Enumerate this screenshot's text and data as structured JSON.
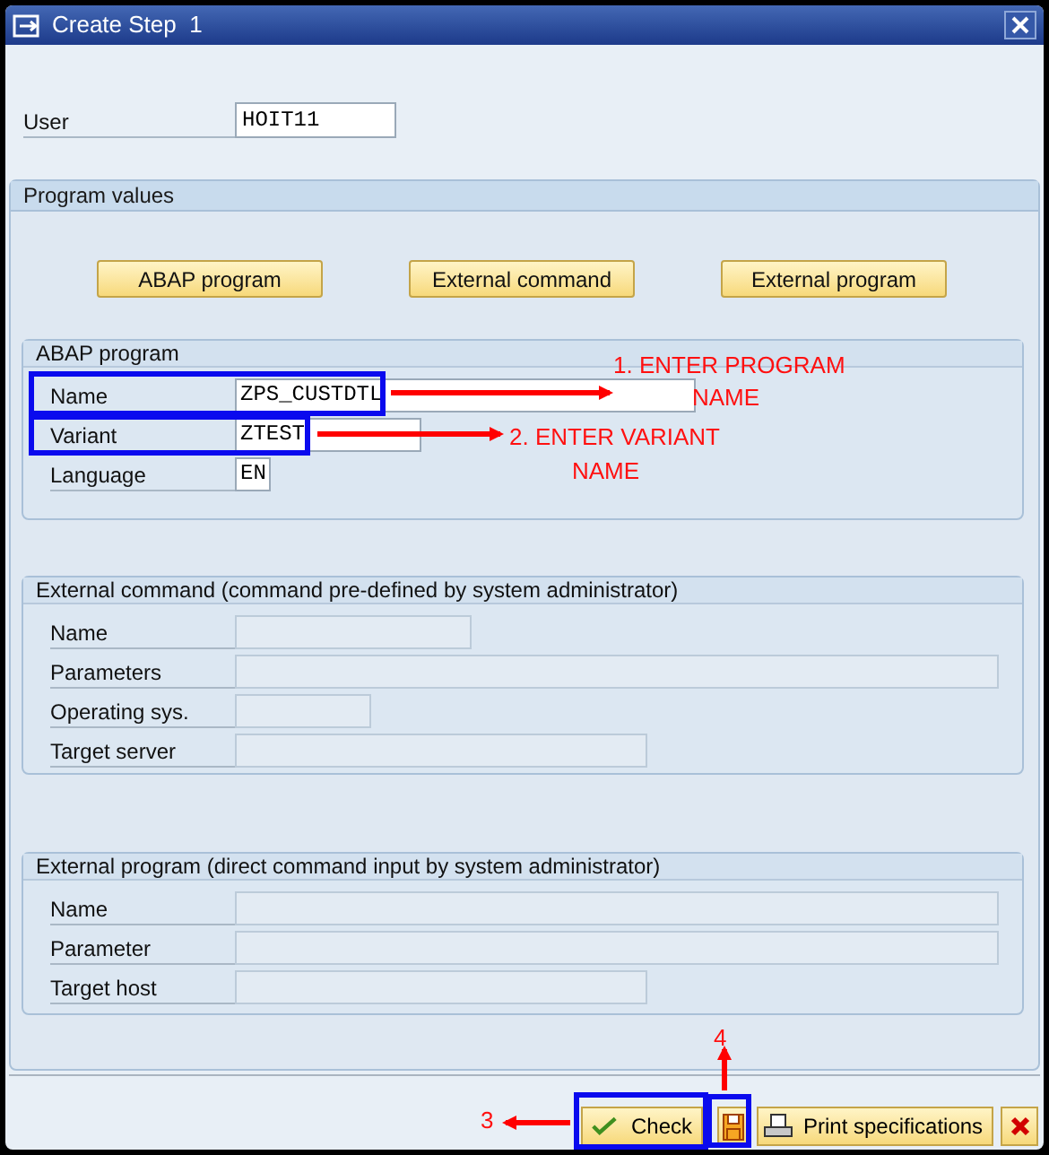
{
  "window": {
    "title": "Create Step  1"
  },
  "user": {
    "label": "User",
    "value": "HOIT11"
  },
  "program_values": {
    "title": "Program values",
    "buttons": [
      "ABAP program",
      "External command",
      "External program"
    ],
    "groups": [
      {
        "title": "ABAP program",
        "fields": [
          {
            "label": "Name",
            "value": "ZPS_CUSTDTL",
            "disabled": false
          },
          {
            "label": "Variant",
            "value": "ZTEST",
            "disabled": false
          },
          {
            "label": "Language",
            "value": "EN",
            "disabled": false
          }
        ]
      },
      {
        "title": "External command (command pre-defined by system administrator)",
        "fields": [
          {
            "label": "Name",
            "disabled": true
          },
          {
            "label": "Parameters",
            "disabled": true
          },
          {
            "label": "Operating sys.",
            "disabled": true
          },
          {
            "label": "Target server",
            "disabled": true
          }
        ]
      },
      {
        "title": "External program (direct command input by system administrator)",
        "fields": [
          {
            "label": "Name",
            "disabled": true
          },
          {
            "label": "Parameter",
            "disabled": true
          },
          {
            "label": "Target host",
            "disabled": true
          }
        ]
      }
    ]
  },
  "footer_buttons": [
    {
      "kind": "check",
      "label": "Check"
    },
    {
      "kind": "save"
    },
    {
      "kind": "print",
      "label": "Print specifications"
    },
    {
      "kind": "cancel"
    }
  ],
  "annotations": [
    {
      "lines": [
        "1. ENTER PROGRAM",
        "NAME"
      ]
    },
    {
      "lines": [
        "2. ENTER VARIANT",
        "NAME"
      ]
    },
    {
      "lines": [
        "3"
      ]
    },
    {
      "lines": [
        "4"
      ]
    }
  ]
}
